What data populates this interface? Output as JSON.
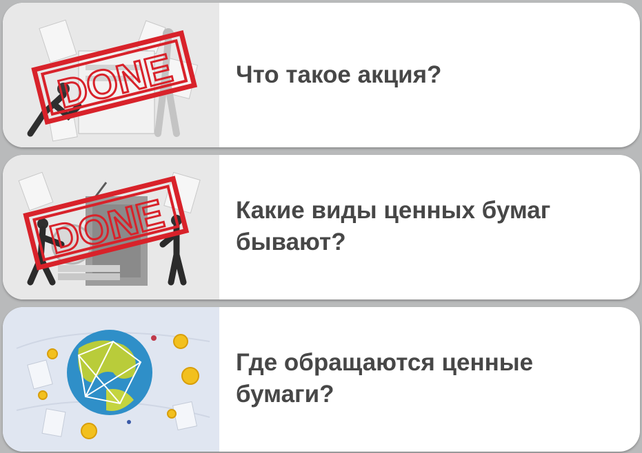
{
  "lessons": [
    {
      "title": "Что такое акция?",
      "status": "DONE",
      "image": "people-pulling-stock-paper-illustration"
    },
    {
      "title": "Какие виды ценных бумаг бывают?",
      "status": "DONE",
      "image": "people-with-securities-safe-illustration"
    },
    {
      "title": "Где обращаются ценные бумаги?",
      "status": "",
      "image": "globe-with-coins-illustration"
    }
  ],
  "colors": {
    "stamp": "#d8222a",
    "title": "#474747",
    "card": "#ffffff",
    "background": "#b9babb"
  }
}
